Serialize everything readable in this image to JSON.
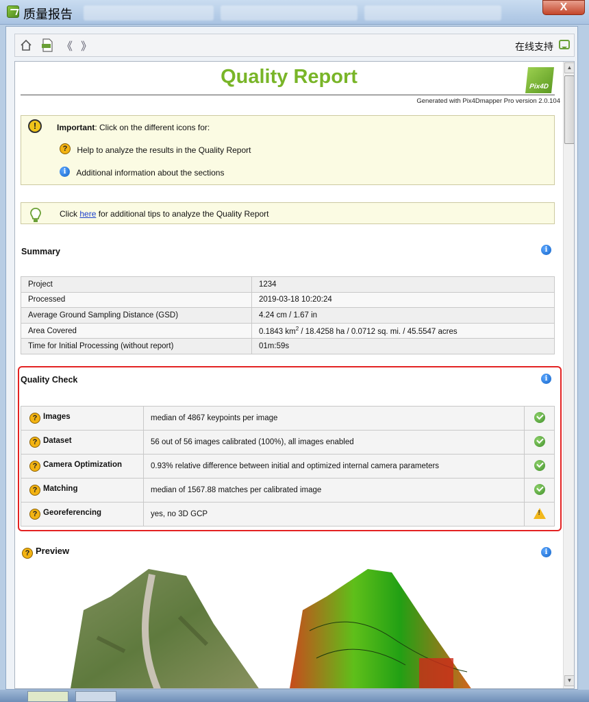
{
  "window": {
    "title": "质量报告",
    "close_label": "X"
  },
  "toolbar": {
    "pdf_label": "PDF",
    "back_label": "《",
    "forward_label": "》",
    "support_label": "在线支持"
  },
  "report": {
    "title": "Quality Report",
    "logo_text": "Pix4D",
    "generated": "Generated with Pix4Dmapper Pro version 2.0.104",
    "important_prefix": "Important",
    "important_text": ": Click on the different icons for:",
    "help_text": "Help to analyze the results in the Quality Report",
    "info_text": "Additional information about the sections",
    "tips_pre": "Click ",
    "tips_link": "here",
    "tips_post": " for additional tips to analyze the Quality Report"
  },
  "summary": {
    "title": "Summary",
    "rows": [
      {
        "label": "Project",
        "value": "1234"
      },
      {
        "label": "Processed",
        "value": "2019-03-18 10:20:24"
      },
      {
        "label": "Average Ground Sampling Distance (GSD)",
        "value": "4.24 cm / 1.67 in"
      },
      {
        "label": "Area Covered",
        "value_pre": "0.1843 km",
        "value_sup": "2",
        "value_post": " / 18.4258 ha / 0.0712 sq. mi. / 45.5547 acres"
      },
      {
        "label": "Time for Initial Processing (without report)",
        "value": "01m:59s"
      }
    ]
  },
  "quality_check": {
    "title": "Quality Check",
    "rows": [
      {
        "label": "Images",
        "value": "median of 4867 keypoints per image",
        "status": "ok"
      },
      {
        "label": "Dataset",
        "value": "56 out of 56 images calibrated (100%), all images enabled",
        "status": "ok"
      },
      {
        "label": "Camera Optimization",
        "value": "0.93% relative difference between initial and optimized internal camera parameters",
        "status": "ok"
      },
      {
        "label": "Matching",
        "value": "median of 1567.88 matches per calibrated image",
        "status": "ok"
      },
      {
        "label": "Georeferencing",
        "value": "yes, no 3D GCP",
        "status": "warning"
      }
    ]
  },
  "preview": {
    "title": "Preview"
  },
  "colors": {
    "accent": "#79b528",
    "highlight_frame": "#e32222",
    "info": "#1565c8",
    "help": "#f3b312"
  }
}
